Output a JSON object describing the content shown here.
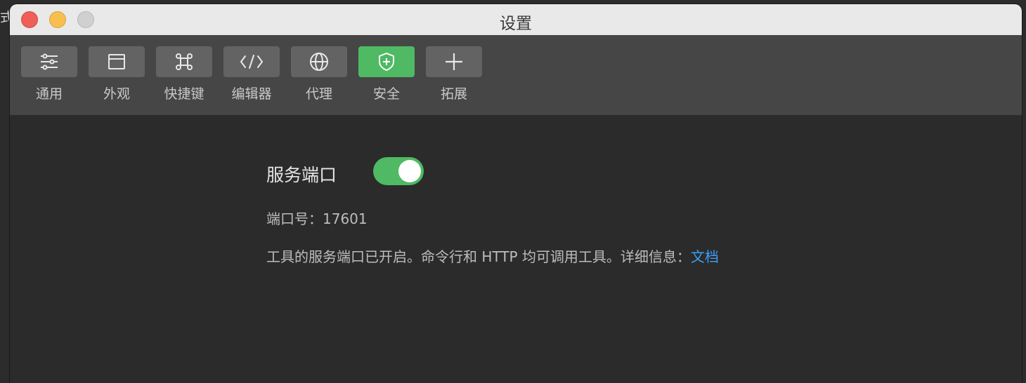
{
  "background_app": {
    "partial_text": "式"
  },
  "window": {
    "title": "设置"
  },
  "toolbar": {
    "items": [
      {
        "label": "通用",
        "icon": "sliders-icon"
      },
      {
        "label": "外观",
        "icon": "window-icon"
      },
      {
        "label": "快捷键",
        "icon": "command-key-icon"
      },
      {
        "label": "编辑器",
        "icon": "code-icon"
      },
      {
        "label": "代理",
        "icon": "globe-icon"
      },
      {
        "label": "安全",
        "icon": "shield-plus-icon",
        "active": true
      },
      {
        "label": "拓展",
        "icon": "plus-icon"
      }
    ]
  },
  "service": {
    "title": "服务端口",
    "enabled": true,
    "port_label": "端口号：",
    "port": "17601",
    "description": "工具的服务端口已开启。命令行和 HTTP 均可调用工具。详细信息：",
    "doc_link": "文档"
  },
  "colors": {
    "accent_green": "#4fba63",
    "link_blue": "#3d9cf5",
    "close": "#ee5f57",
    "minimize": "#f6bf4f"
  }
}
